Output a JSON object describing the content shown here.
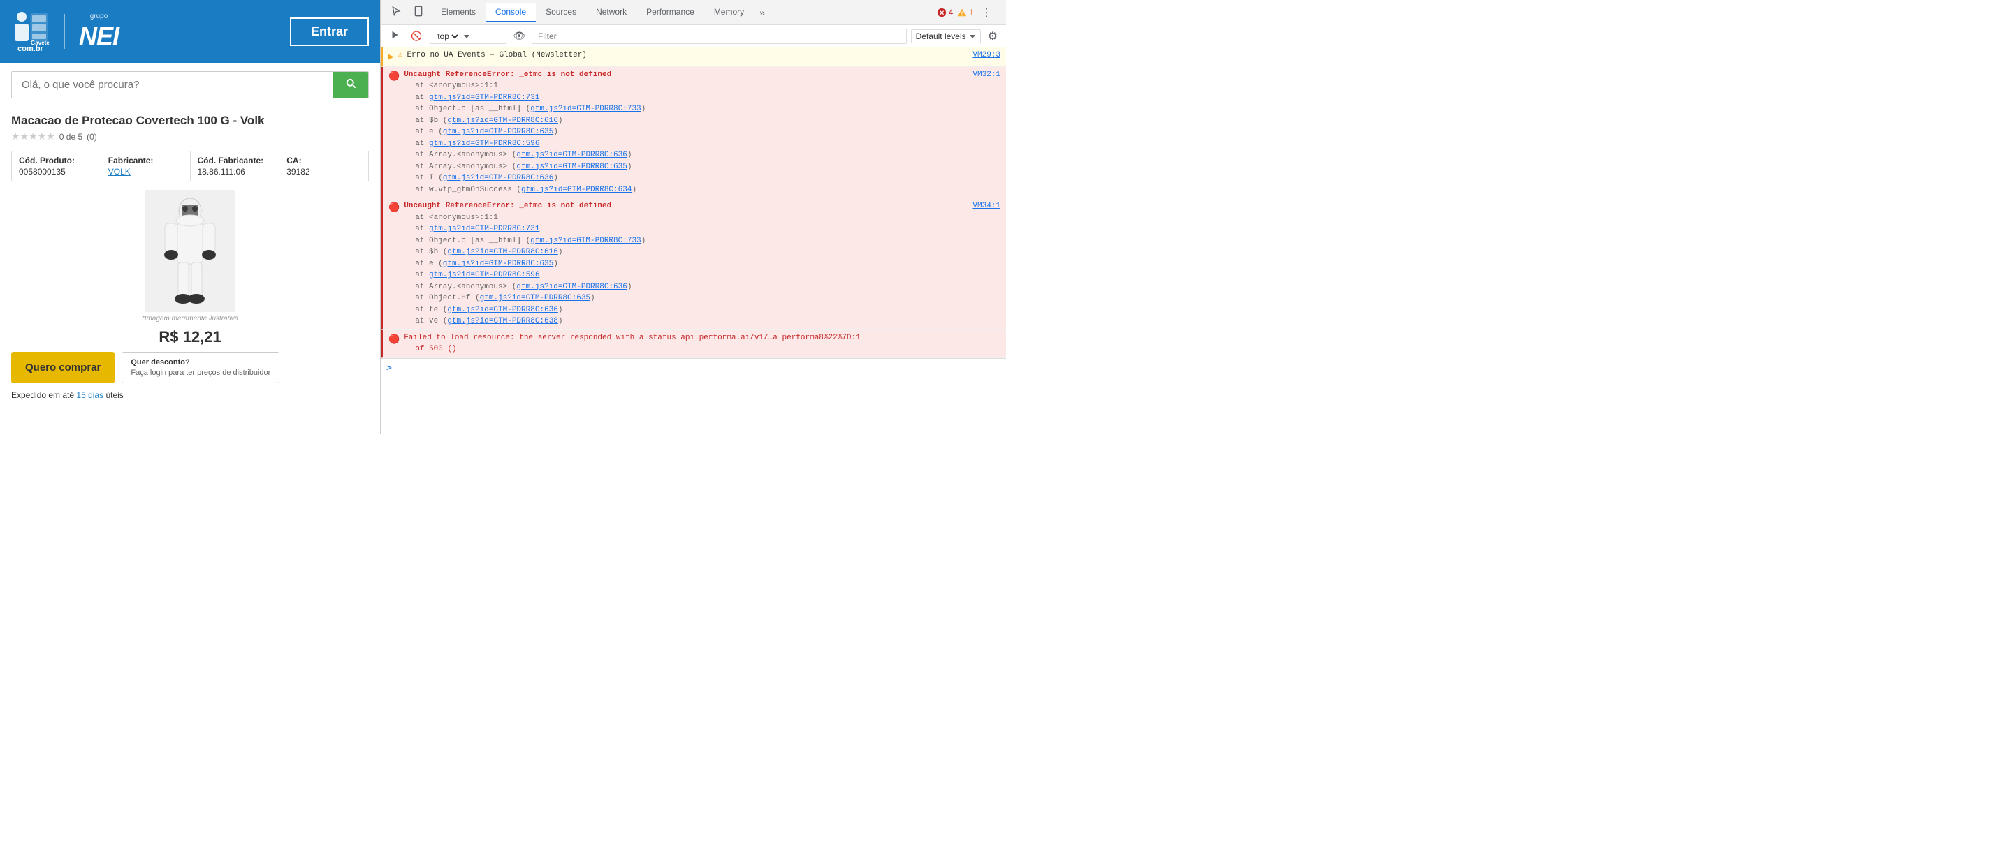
{
  "website": {
    "header": {
      "logo_main": "Gaveteiro",
      "logo_sub": "com.br",
      "logo_group": "grupo",
      "logo_nei": "NEI",
      "enter_button": "Entrar"
    },
    "search": {
      "placeholder": "Olá, o que você procura?"
    },
    "product": {
      "title": "Macacao de Protecao Covertech 100 G - Volk",
      "rating_text": "0 de 5",
      "rating_count": "(0)",
      "cod_produto_label": "Cód. Produto:",
      "cod_produto_value": "0058000135",
      "fabricante_label": "Fabricante:",
      "fabricante_value": "VOLK",
      "cod_fabricante_label": "Cód. Fabricante:",
      "cod_fabricante_value": "18.86.111.06",
      "ca_label": "CA:",
      "ca_value": "39182",
      "image_note": "*Imagem meramente ilustrativa",
      "price": "R$ 12,21",
      "buy_button": "Quero comprar",
      "discount_title": "Quer desconto?",
      "discount_text": "Faça login para ter preços de distribuidor",
      "shipping_text": "Expedido em até",
      "shipping_days": "15 dias",
      "shipping_suffix": "úteis"
    }
  },
  "devtools": {
    "tabs": {
      "elements": "Elements",
      "console": "Console",
      "sources": "Sources",
      "network": "Network",
      "performance": "Performance",
      "memory": "Memory",
      "more": "»"
    },
    "badges": {
      "errors": "4",
      "warnings": "1"
    },
    "console_toolbar": {
      "context": "top",
      "filter_placeholder": "Filter",
      "levels": "Default levels"
    },
    "messages": [
      {
        "type": "warn",
        "expand": true,
        "text": "Erro no UA Events – Global (Newsletter)",
        "source": "VM29:3"
      },
      {
        "type": "error",
        "expand": false,
        "main_text": "Uncaught ReferenceError: _etmc is not defined",
        "source": "VM32:1",
        "stack": [
          "at <anonymous>:1:1",
          "at gtm.js?id=GTM-PDRR8C:731",
          "at Object.c [as __html] (gtm.js?id=GTM-PDRR8C:733)",
          "at $b (gtm.js?id=GTM-PDRR8C:616)",
          "at e (gtm.js?id=GTM-PDRR8C:635)",
          "at gtm.js?id=GTM-PDRR8C:596",
          "at Array.<anonymous> (gtm.js?id=GTM-PDRR8C:636)",
          "at Array.<anonymous> (gtm.js?id=GTM-PDRR8C:635)",
          "at I (gtm.js?id=GTM-PDRR8C:636)",
          "at w.vtp_gtmOnSuccess (gtm.js?id=GTM-PDRR8C:634)"
        ]
      },
      {
        "type": "error",
        "expand": false,
        "main_text": "Uncaught ReferenceError: _etmc is not defined",
        "source": "VM34:1",
        "stack": [
          "at <anonymous>:1:1",
          "at gtm.js?id=GTM-PDRR8C:731",
          "at Object.c [as __html] (gtm.js?id=GTM-PDRR8C:733)",
          "at $b (gtm.js?id=GTM-PDRR8C:616)",
          "at e (gtm.js?id=GTM-PDRR8C:635)",
          "at gtm.js?id=GTM-PDRR8C:596",
          "at Array.<anonymous> (gtm.js?id=GTM-PDRR8C:636)",
          "at Object.Hf (gtm.js?id=GTM-PDRR8C:635)",
          "at te (gtm.js?id=GTM-PDRR8C:636)",
          "at ve (gtm.js?id=GTM-PDRR8C:638)"
        ]
      },
      {
        "type": "network-error",
        "text": "Failed to load resource: the server responded with a status",
        "link_text": "api.performa.ai/v1/…a performa8%22%7D:1",
        "suffix_text": "of 500 ()"
      }
    ],
    "console_input": ">"
  }
}
